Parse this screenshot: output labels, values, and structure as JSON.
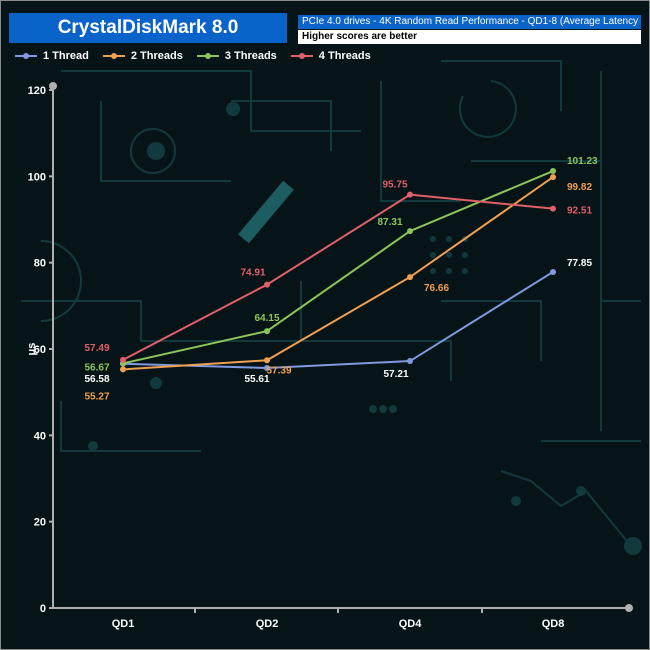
{
  "header": {
    "app_title": "CrystalDiskMark 8.0",
    "subtitle": "PCIe 4.0 drives - 4K Random Read Performance - QD1-8 (Average Latency v QD)",
    "note": "Higher scores are better"
  },
  "chart_data": {
    "type": "line",
    "title": "PCIe 4.0 drives - 4K Random Read Performance - QD1-8 (Average Latency v QD)",
    "categories": [
      "QD1",
      "QD2",
      "QD4",
      "QD8"
    ],
    "ylabel": "μs",
    "xlabel": "",
    "ylim": [
      0,
      120
    ],
    "yticks": [
      0,
      20,
      40,
      60,
      80,
      100,
      120
    ],
    "grid": false,
    "legend_position": "top-left",
    "series": [
      {
        "name": "1 Thread",
        "color": "#7f9ae0",
        "values": [
          56.58,
          55.61,
          57.21,
          77.85
        ],
        "label_values": [
          "56.58",
          "55.61",
          "57.21",
          "77.85"
        ],
        "label_color": "#ffffff"
      },
      {
        "name": "2 Threads",
        "color": "#f0a050",
        "values": [
          55.27,
          57.39,
          76.66,
          99.82
        ],
        "label_values": [
          "55.27",
          "57.39",
          "76.66",
          "99.82"
        ],
        "label_color": "#f0a050"
      },
      {
        "name": "3 Threads",
        "color": "#8cc65a",
        "values": [
          56.67,
          64.15,
          87.31,
          101.23
        ],
        "label_values": [
          "56.67",
          "64.15",
          "87.31",
          "101.23"
        ],
        "label_color": "#8cc65a"
      },
      {
        "name": "4 Threads",
        "color": "#e0606a",
        "values": [
          57.49,
          74.91,
          95.75,
          92.51
        ],
        "label_values": [
          "57.49",
          "74.91",
          "95.75",
          "92.51"
        ],
        "label_color": "#e0606a"
      }
    ]
  }
}
